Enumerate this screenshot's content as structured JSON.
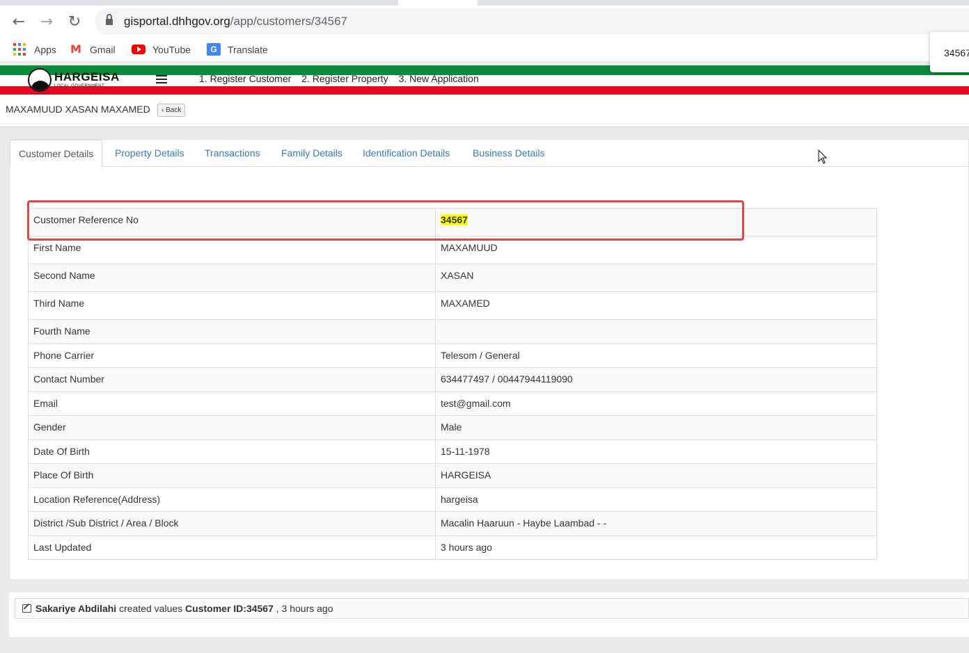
{
  "browser": {
    "url_host": "gisportal.dhhgov.org",
    "url_path": "/app/customers/34567",
    "back_icon": "arrow-left",
    "forward_icon": "arrow-right",
    "reload_icon": "reload",
    "bookmarks": [
      "Apps",
      "Gmail",
      "YouTube",
      "Translate"
    ],
    "find_popup_text": "34567"
  },
  "app": {
    "logo_text": "HARGEISA",
    "logo_sub": "LOCAL GOVERNMENT",
    "nav": [
      "1. Register Customer",
      "2. Register Property",
      "3. New Application"
    ]
  },
  "page": {
    "title": "MAXAMUUD XASAN MAXAMED",
    "back_label": "Back"
  },
  "tabs": [
    "Customer Details",
    "Property Details",
    "Transactions",
    "Family Details",
    "Identification Details",
    "Business Details"
  ],
  "details": [
    {
      "label": "Customer Reference No",
      "value": "34567"
    },
    {
      "label": "First Name",
      "value": "MAXAMUUD"
    },
    {
      "label": "Second Name",
      "value": "XASAN"
    },
    {
      "label": "Third Name",
      "value": "MAXAMED"
    },
    {
      "label": "Fourth Name",
      "value": ""
    },
    {
      "label": "Phone Carrier",
      "value": "Telesom / General"
    },
    {
      "label": "Contact Number",
      "value": "634477497 / 00447944119090"
    },
    {
      "label": "Email",
      "value": "test@gmail.com"
    },
    {
      "label": "Gender",
      "value": "Male"
    },
    {
      "label": "Date Of Birth",
      "value": "15-11-1978"
    },
    {
      "label": "Place Of Birth",
      "value": "HARGEISA"
    },
    {
      "label": "Location Reference(Address)",
      "value": "hargeisa"
    },
    {
      "label": "District /Sub District / Area / Block",
      "value": "Macalin Haaruun - Haybe Laambad - -"
    },
    {
      "label": "Last Updated",
      "value": "3 hours ago"
    }
  ],
  "log": {
    "user": "Sakariye Abdilahi",
    "action": "created values",
    "target": "Customer ID:34567",
    "when": ", 3 hours ago"
  },
  "colors": {
    "link": "#337ab7",
    "highlight": "#ffff00",
    "annotation_box": "#e04848",
    "flag_green": "#0b8a3b",
    "flag_red": "#e4071d"
  }
}
